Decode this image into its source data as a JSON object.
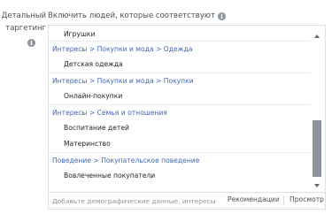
{
  "sidebar_label": {
    "line1": "Детальный",
    "line2": "таргетинг",
    "info_icon": "info-icon"
  },
  "header": {
    "text": "Включить людей, которые соответствуют",
    "info_icon": "info-icon"
  },
  "list": [
    {
      "type": "item",
      "label": "Игрушки"
    },
    {
      "type": "group",
      "label": "Интересы > Покупки и мода > Одежда"
    },
    {
      "type": "item",
      "label": "Детская одежда"
    },
    {
      "type": "group",
      "label": "Интересы > Покупки и мода > Покупки"
    },
    {
      "type": "item",
      "label": "Онлайн-покупки"
    },
    {
      "type": "group",
      "label": "Интересы > Семья и отношения"
    },
    {
      "type": "item",
      "label": "Воспитание детей"
    },
    {
      "type": "item",
      "label": "Материнство"
    },
    {
      "type": "group",
      "label": "Поведение > Покупательское поведение"
    },
    {
      "type": "item",
      "label": "Вовлеченные покупатели"
    }
  ],
  "footer": {
    "search_placeholder": "Добавьте демографические данные, интересы или",
    "recommendations_label": "Рекомендации",
    "browse_label": "Просмотр"
  }
}
